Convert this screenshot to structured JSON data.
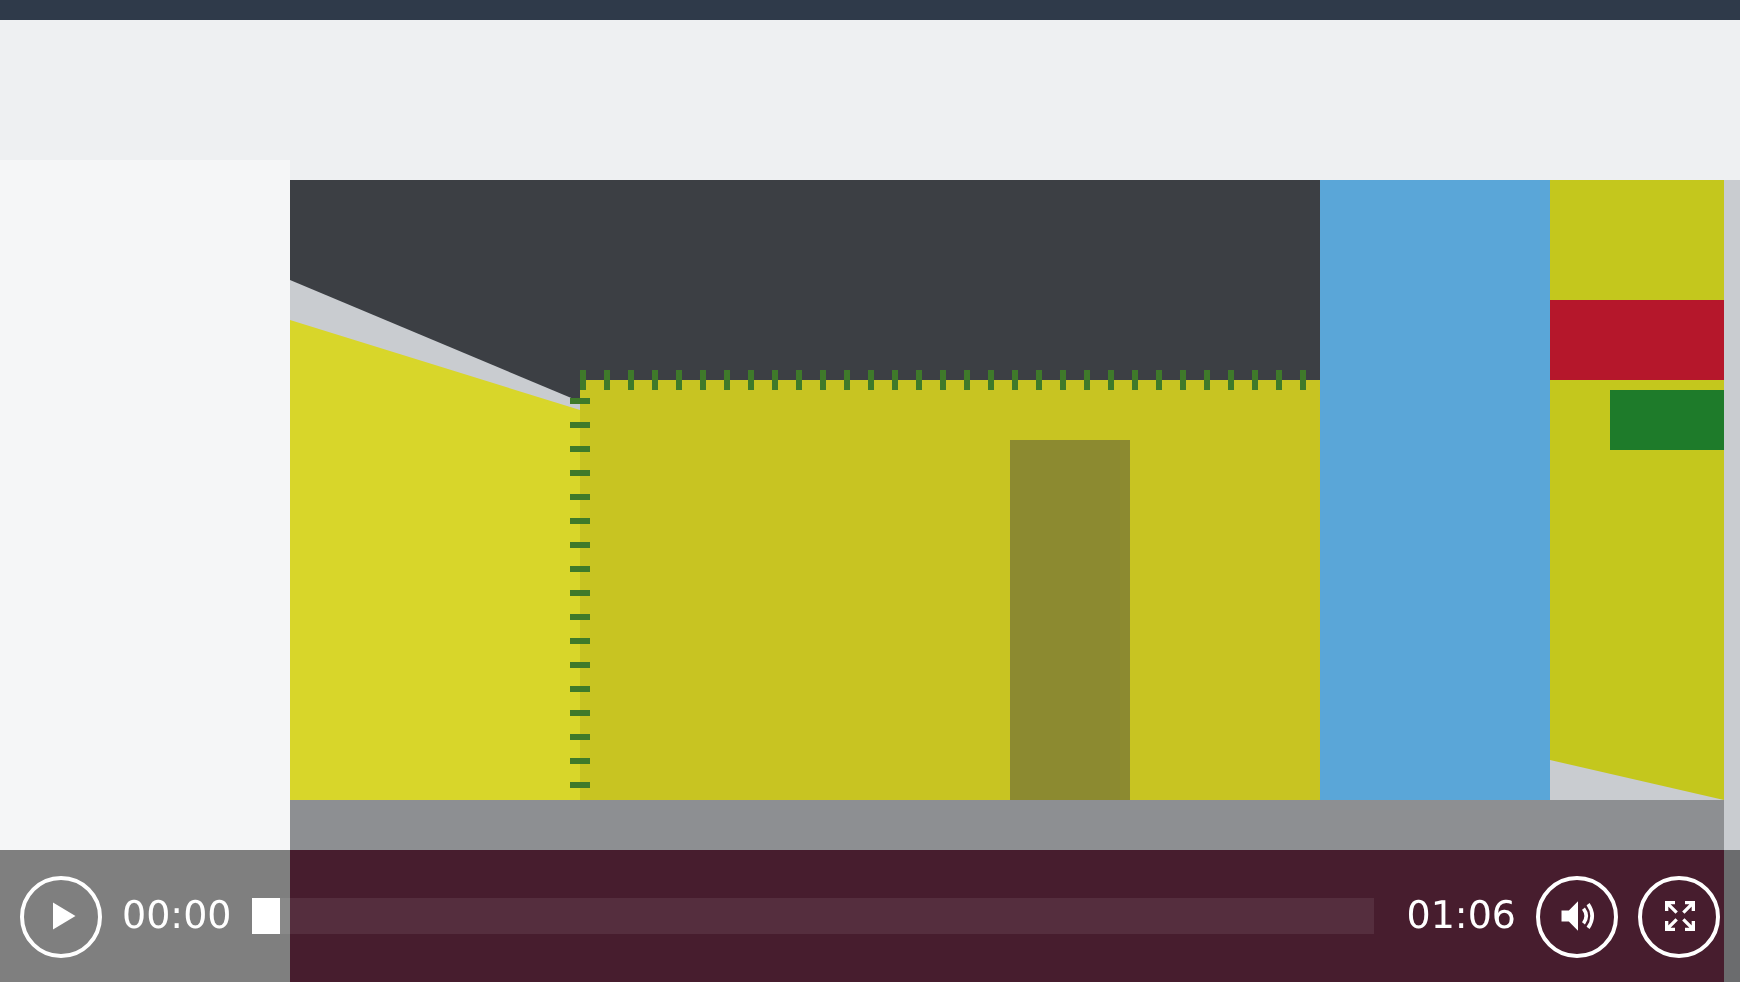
{
  "player": {
    "kind": "picture",
    "controls": {
      "play": {
        "playing": false
      },
      "elapsed": "00:00",
      "progress": {
        "level": 0
      },
      "duration": "01:06",
      "muted": false
    }
  }
}
